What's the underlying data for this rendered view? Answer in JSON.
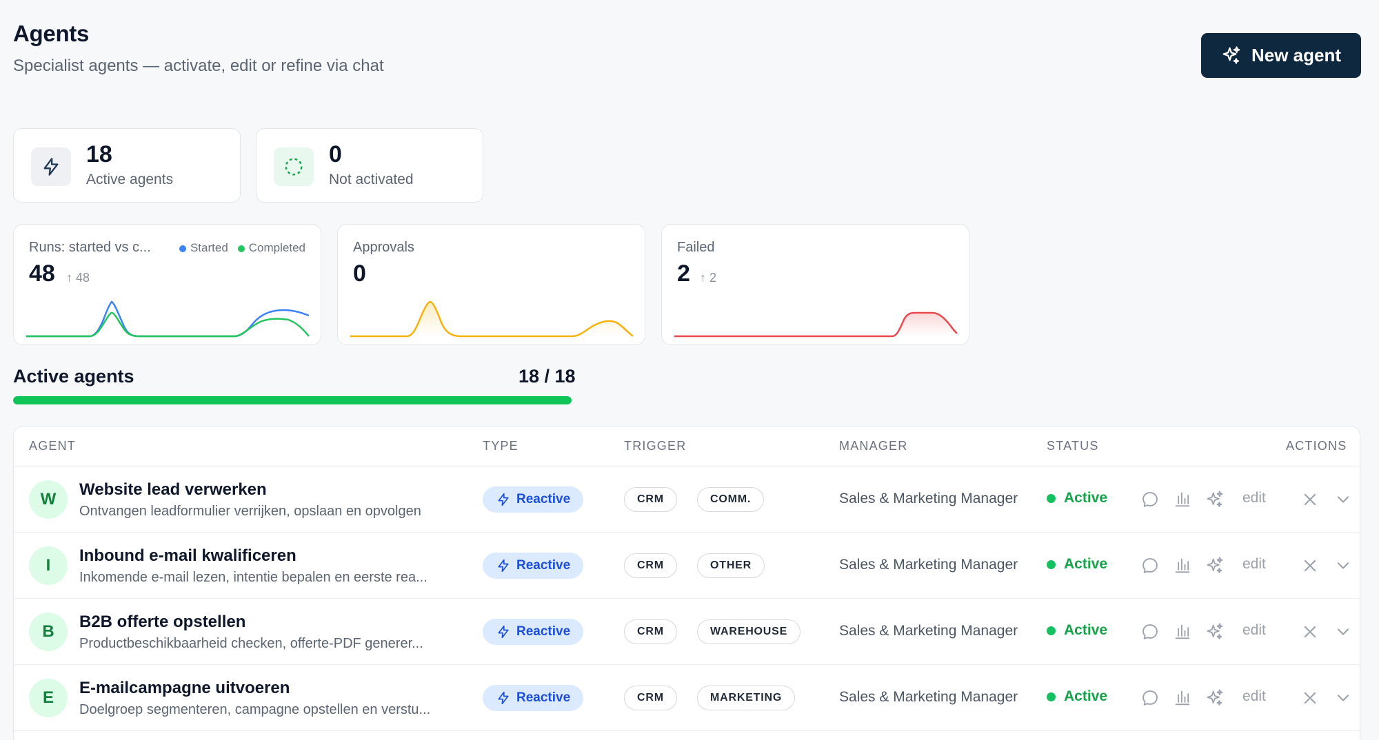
{
  "header": {
    "title": "Agents",
    "subtitle": "Specialist agents — activate, edit or refine via chat",
    "new_agent_label": "New agent"
  },
  "stats": [
    {
      "value": "18",
      "label": "Active agents",
      "icon": "bolt-icon"
    },
    {
      "value": "0",
      "label": "Not activated",
      "icon": "dashed-circle-icon"
    }
  ],
  "sparks": {
    "runs": {
      "title": "Runs: started vs c...",
      "value": "48",
      "delta": "↑ 48",
      "legend": [
        {
          "name": "Started",
          "color": "#3b82f6"
        },
        {
          "name": "Completed",
          "color": "#22c55e"
        }
      ]
    },
    "approvals": {
      "title": "Approvals",
      "value": "0",
      "color": "#f5b20b"
    },
    "failed": {
      "title": "Failed",
      "value": "2",
      "delta": "↑ 2",
      "color": "#e8484e"
    }
  },
  "section": {
    "title": "Active agents",
    "count": "18 / 18",
    "progress": 1.0
  },
  "table": {
    "columns": {
      "agent": "AGENT",
      "type": "TYPE",
      "trigger": "TRIGGER",
      "manager": "MANAGER",
      "status": "STATUS",
      "actions": "ACTIONS"
    },
    "edit_label": "edit",
    "rows": [
      {
        "initial": "W",
        "name": "Website lead verwerken",
        "desc": "Ontvangen leadformulier verrijken, opslaan en opvolgen",
        "type": "Reactive",
        "triggers": [
          "CRM",
          "COMM."
        ],
        "manager": "Sales & Marketing Manager",
        "status": "Active"
      },
      {
        "initial": "I",
        "name": "Inbound e-mail kwalificeren",
        "desc": "Inkomende e-mail lezen, intentie bepalen en eerste rea...",
        "type": "Reactive",
        "triggers": [
          "CRM",
          "OTHER"
        ],
        "manager": "Sales & Marketing Manager",
        "status": "Active"
      },
      {
        "initial": "B",
        "name": "B2B offerte opstellen",
        "desc": "Productbeschikbaarheid checken, offerte-PDF generer...",
        "type": "Reactive",
        "triggers": [
          "CRM",
          "WAREHOUSE"
        ],
        "manager": "Sales & Marketing Manager",
        "status": "Active"
      },
      {
        "initial": "E",
        "name": "E-mailcampagne uitvoeren",
        "desc": "Doelgroep segmenteren, campagne opstellen en verstu...",
        "type": "Reactive",
        "triggers": [
          "CRM",
          "MARKETING"
        ],
        "manager": "Sales & Marketing Manager",
        "status": "Active"
      }
    ]
  }
}
